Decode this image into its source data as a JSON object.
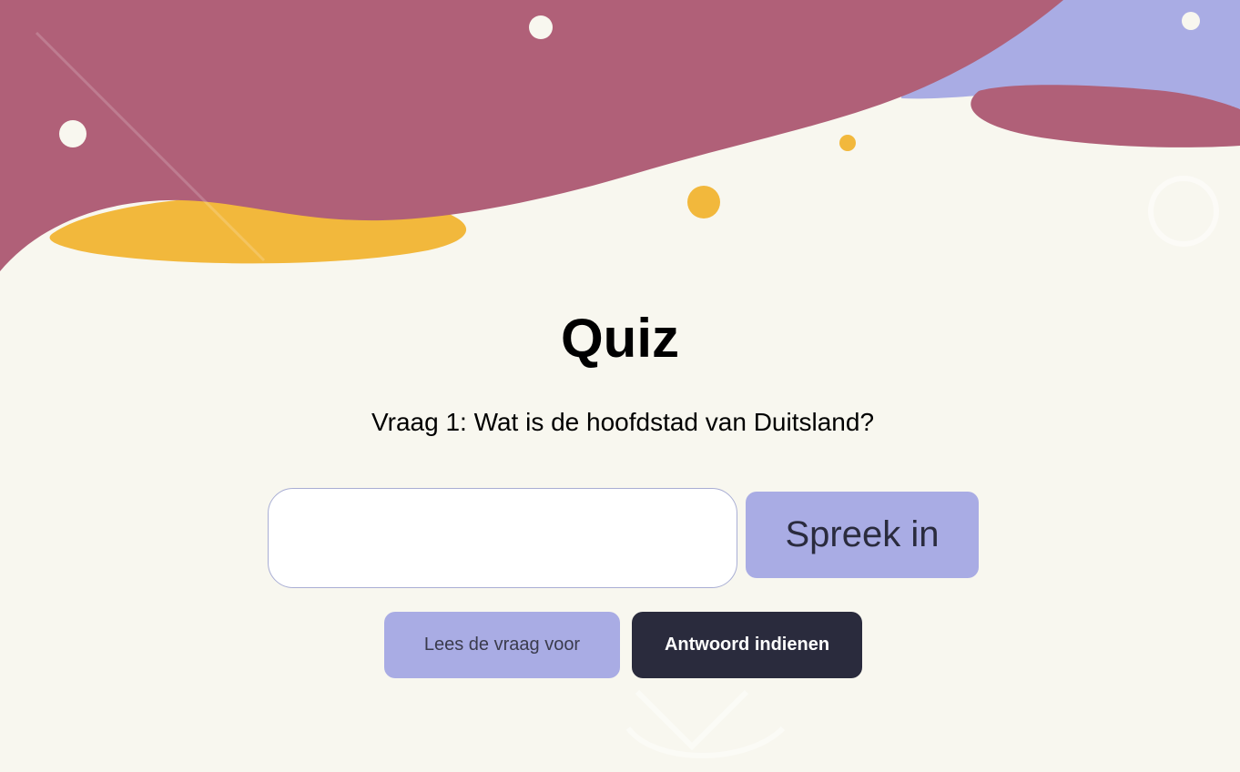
{
  "page": {
    "title": "Quiz",
    "question": "Vraag 1: Wat is de hoofdstad van Duitsland?"
  },
  "answer": {
    "value": "",
    "placeholder": ""
  },
  "buttons": {
    "speak_label": "Spreek in",
    "read_label": "Lees de vraag voor",
    "submit_label": "Antwoord indienen"
  },
  "colors": {
    "background": "#f8f7ef",
    "blob_primary": "#b06078",
    "blob_secondary": "#a9ace4",
    "blob_accent": "#f2b83c",
    "button_light": "#a9ace4",
    "button_dark": "#2a2b3d"
  },
  "icons": {
    "decorative": [
      "blob-shape",
      "dot-circle"
    ]
  }
}
